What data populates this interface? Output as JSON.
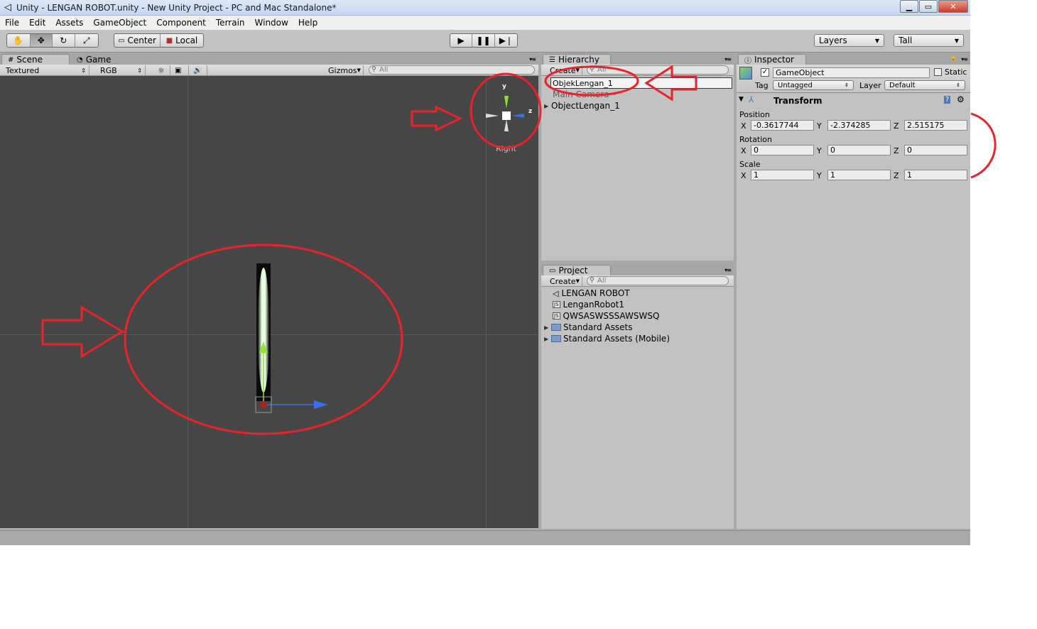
{
  "window": {
    "title": "Unity - LENGAN ROBOT.unity - New Unity Project - PC and Mac Standalone*",
    "controls": [
      "minimize",
      "maximize",
      "close"
    ]
  },
  "menu": [
    "File",
    "Edit",
    "Assets",
    "GameObject",
    "Component",
    "Terrain",
    "Window",
    "Help"
  ],
  "toolbar": {
    "pivot_mode": "Center",
    "pivot_rotation": "Local",
    "layers_dropdown": "Layers",
    "layout_dropdown": "Tall"
  },
  "scene_panel": {
    "tabs": [
      "Scene",
      "Game"
    ],
    "render_mode": "Textured",
    "color_mode": "RGB",
    "gizmos_label": "Gizmos",
    "search_placeholder": "All",
    "gizmo_axes": {
      "y": "y",
      "z": "z"
    },
    "view_label": "Right"
  },
  "hierarchy": {
    "tab": "Hierarchy",
    "create_label": "Create",
    "search_placeholder": "All",
    "rename_value": "ObjekLengan_1",
    "items": [
      "Main Camera",
      "ObjectLengan_1"
    ]
  },
  "project": {
    "tab": "Project",
    "create_label": "Create",
    "search_placeholder": "All",
    "items": [
      "LENGAN ROBOT",
      "LenganRobot1",
      "QWSASWSSSAWSWSQ",
      "Standard Assets",
      "Standard Assets (Mobile)"
    ]
  },
  "inspector": {
    "tab": "Inspector",
    "object_name": "GameObject",
    "static_label": "Static",
    "tag_label": "Tag",
    "tag_value": "Untagged",
    "layer_label": "Layer",
    "layer_value": "Default",
    "component_title": "Transform",
    "position_label": "Position",
    "rotation_label": "Rotation",
    "scale_label": "Scale",
    "axis_labels": {
      "x": "X",
      "y": "Y",
      "z": "Z"
    },
    "position": {
      "x": "-0.3617744",
      "y": "-2.374285",
      "z": "2.515175"
    },
    "rotation": {
      "x": "0",
      "y": "0",
      "z": "0"
    },
    "scale": {
      "x": "1",
      "y": "1",
      "z": "1"
    }
  },
  "colors": {
    "annotation": "#e8232a",
    "viewport": "#464646",
    "gizmo_y": "#8ee53a",
    "gizmo_z": "#3a6ee8"
  }
}
